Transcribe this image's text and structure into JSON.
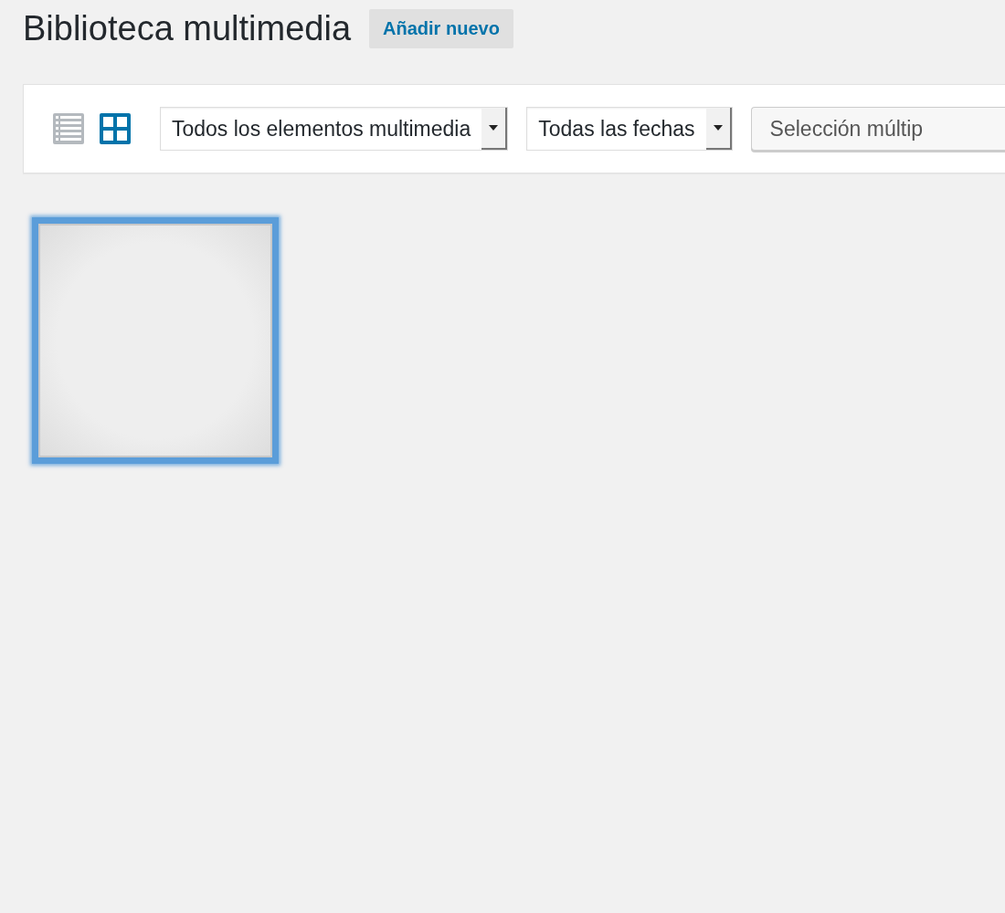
{
  "page_title": "Biblioteca multimedia",
  "add_new_button": "Añadir nuevo",
  "toolbar": {
    "view_modes": [
      {
        "kind": "list",
        "selected": false
      },
      {
        "kind": "grid",
        "selected": true
      }
    ],
    "filters": [
      {
        "value": "Todos los elementos multimedia"
      },
      {
        "value": "Todas las fechas"
      }
    ],
    "bulk_select_button": "Selección múltip"
  },
  "attachments": [
    {
      "kind": "picture",
      "selected": true
    }
  ]
}
